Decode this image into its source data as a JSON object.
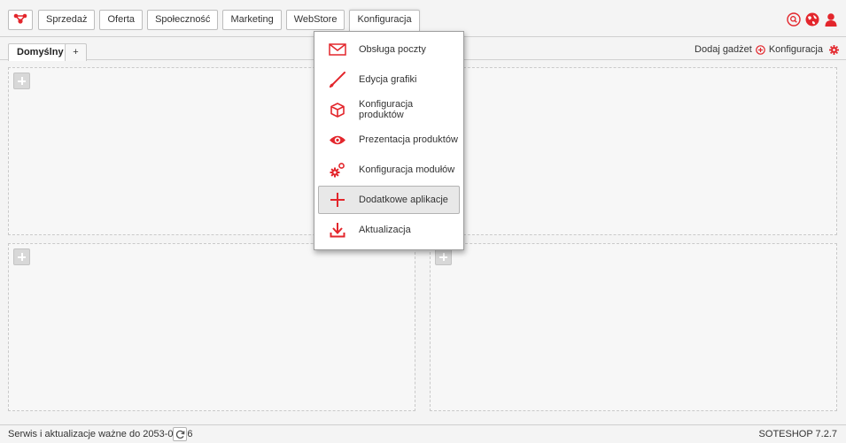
{
  "nav": {
    "items": [
      "Sprzedaż",
      "Oferta",
      "Społeczność",
      "Marketing",
      "WebStore",
      "Konfiguracja"
    ],
    "logo_icon": "network-logo-icon",
    "right_icons": [
      "search-icon",
      "globe-icon",
      "user-icon"
    ]
  },
  "tabs": {
    "active": "Domyślny",
    "add": "+"
  },
  "tools": {
    "add_gadget": "Dodaj gadżet",
    "config": "Konfiguracja"
  },
  "menu": {
    "items": [
      {
        "label": "Obsługa poczty",
        "icon": "mail-icon"
      },
      {
        "label": "Edycja grafiki",
        "icon": "brush-icon"
      },
      {
        "label": "Konfiguracja produktów",
        "icon": "box-icon"
      },
      {
        "label": "Prezentacja produktów",
        "icon": "eye-icon"
      },
      {
        "label": "Konfiguracja modułów",
        "icon": "gears-icon"
      },
      {
        "label": "Dodatkowe aplikacje",
        "icon": "plus-icon"
      },
      {
        "label": "Aktualizacja",
        "icon": "download-icon"
      }
    ],
    "highlighted_index": 5
  },
  "status": {
    "service_text": "Serwis i aktualizacje ważne do 2053-08-26",
    "version": "SOTESHOP 7.2.7"
  },
  "colors": {
    "accent": "#e3262c",
    "background": "#f4f4f4"
  }
}
